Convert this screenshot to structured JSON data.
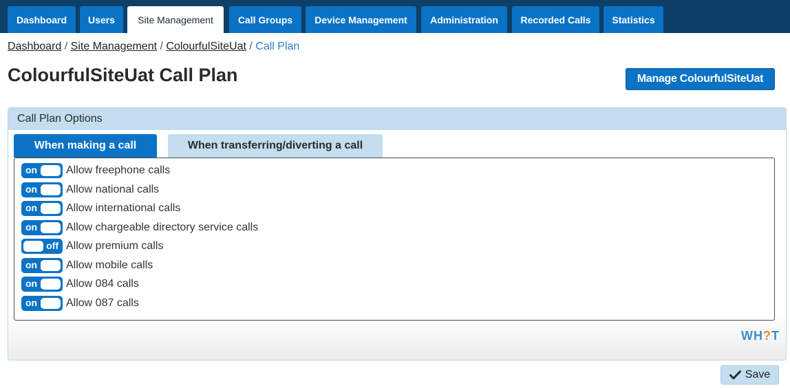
{
  "nav": {
    "tabs": [
      {
        "label": "Dashboard"
      },
      {
        "label": "Users"
      },
      {
        "label": "Site Management"
      },
      {
        "label": "Call Groups"
      },
      {
        "label": "Device Management"
      },
      {
        "label": "Administration"
      },
      {
        "label": "Recorded Calls"
      },
      {
        "label": "Statistics"
      }
    ],
    "active": "Site Management"
  },
  "breadcrumb": {
    "items": [
      "Dashboard",
      "Site Management",
      "ColourfulSiteUat"
    ],
    "separator": "/",
    "current": "Call Plan"
  },
  "page": {
    "title": "ColourfulSiteUat Call Plan",
    "manage_button": "Manage ColourfulSiteUat"
  },
  "panel": {
    "header": "Call Plan Options",
    "tabs": [
      {
        "label": "When making a call",
        "active": true
      },
      {
        "label": "When transferring/diverting a call",
        "active": false
      }
    ],
    "toggle_on_text": "on",
    "toggle_off_text": "off",
    "options": [
      {
        "label": "Allow freephone calls",
        "state": "on"
      },
      {
        "label": "Allow national calls",
        "state": "on"
      },
      {
        "label": "Allow international calls",
        "state": "on"
      },
      {
        "label": "Allow chargeable directory service calls",
        "state": "on"
      },
      {
        "label": "Allow premium calls",
        "state": "off"
      },
      {
        "label": "Allow mobile calls",
        "state": "on"
      },
      {
        "label": "Allow 084 calls",
        "state": "on"
      },
      {
        "label": "Allow 087 calls",
        "state": "on"
      }
    ]
  },
  "logo": {
    "part1": "WH",
    "part2": "?",
    "part3": "T"
  },
  "save_button": "Save",
  "colors": {
    "nav_bg": "#0d3f67",
    "accent": "#0a73c6",
    "panel_header": "#c4def0",
    "logo_orange": "#e98a2b"
  },
  "icons": {
    "save": "checkmark-icon"
  }
}
